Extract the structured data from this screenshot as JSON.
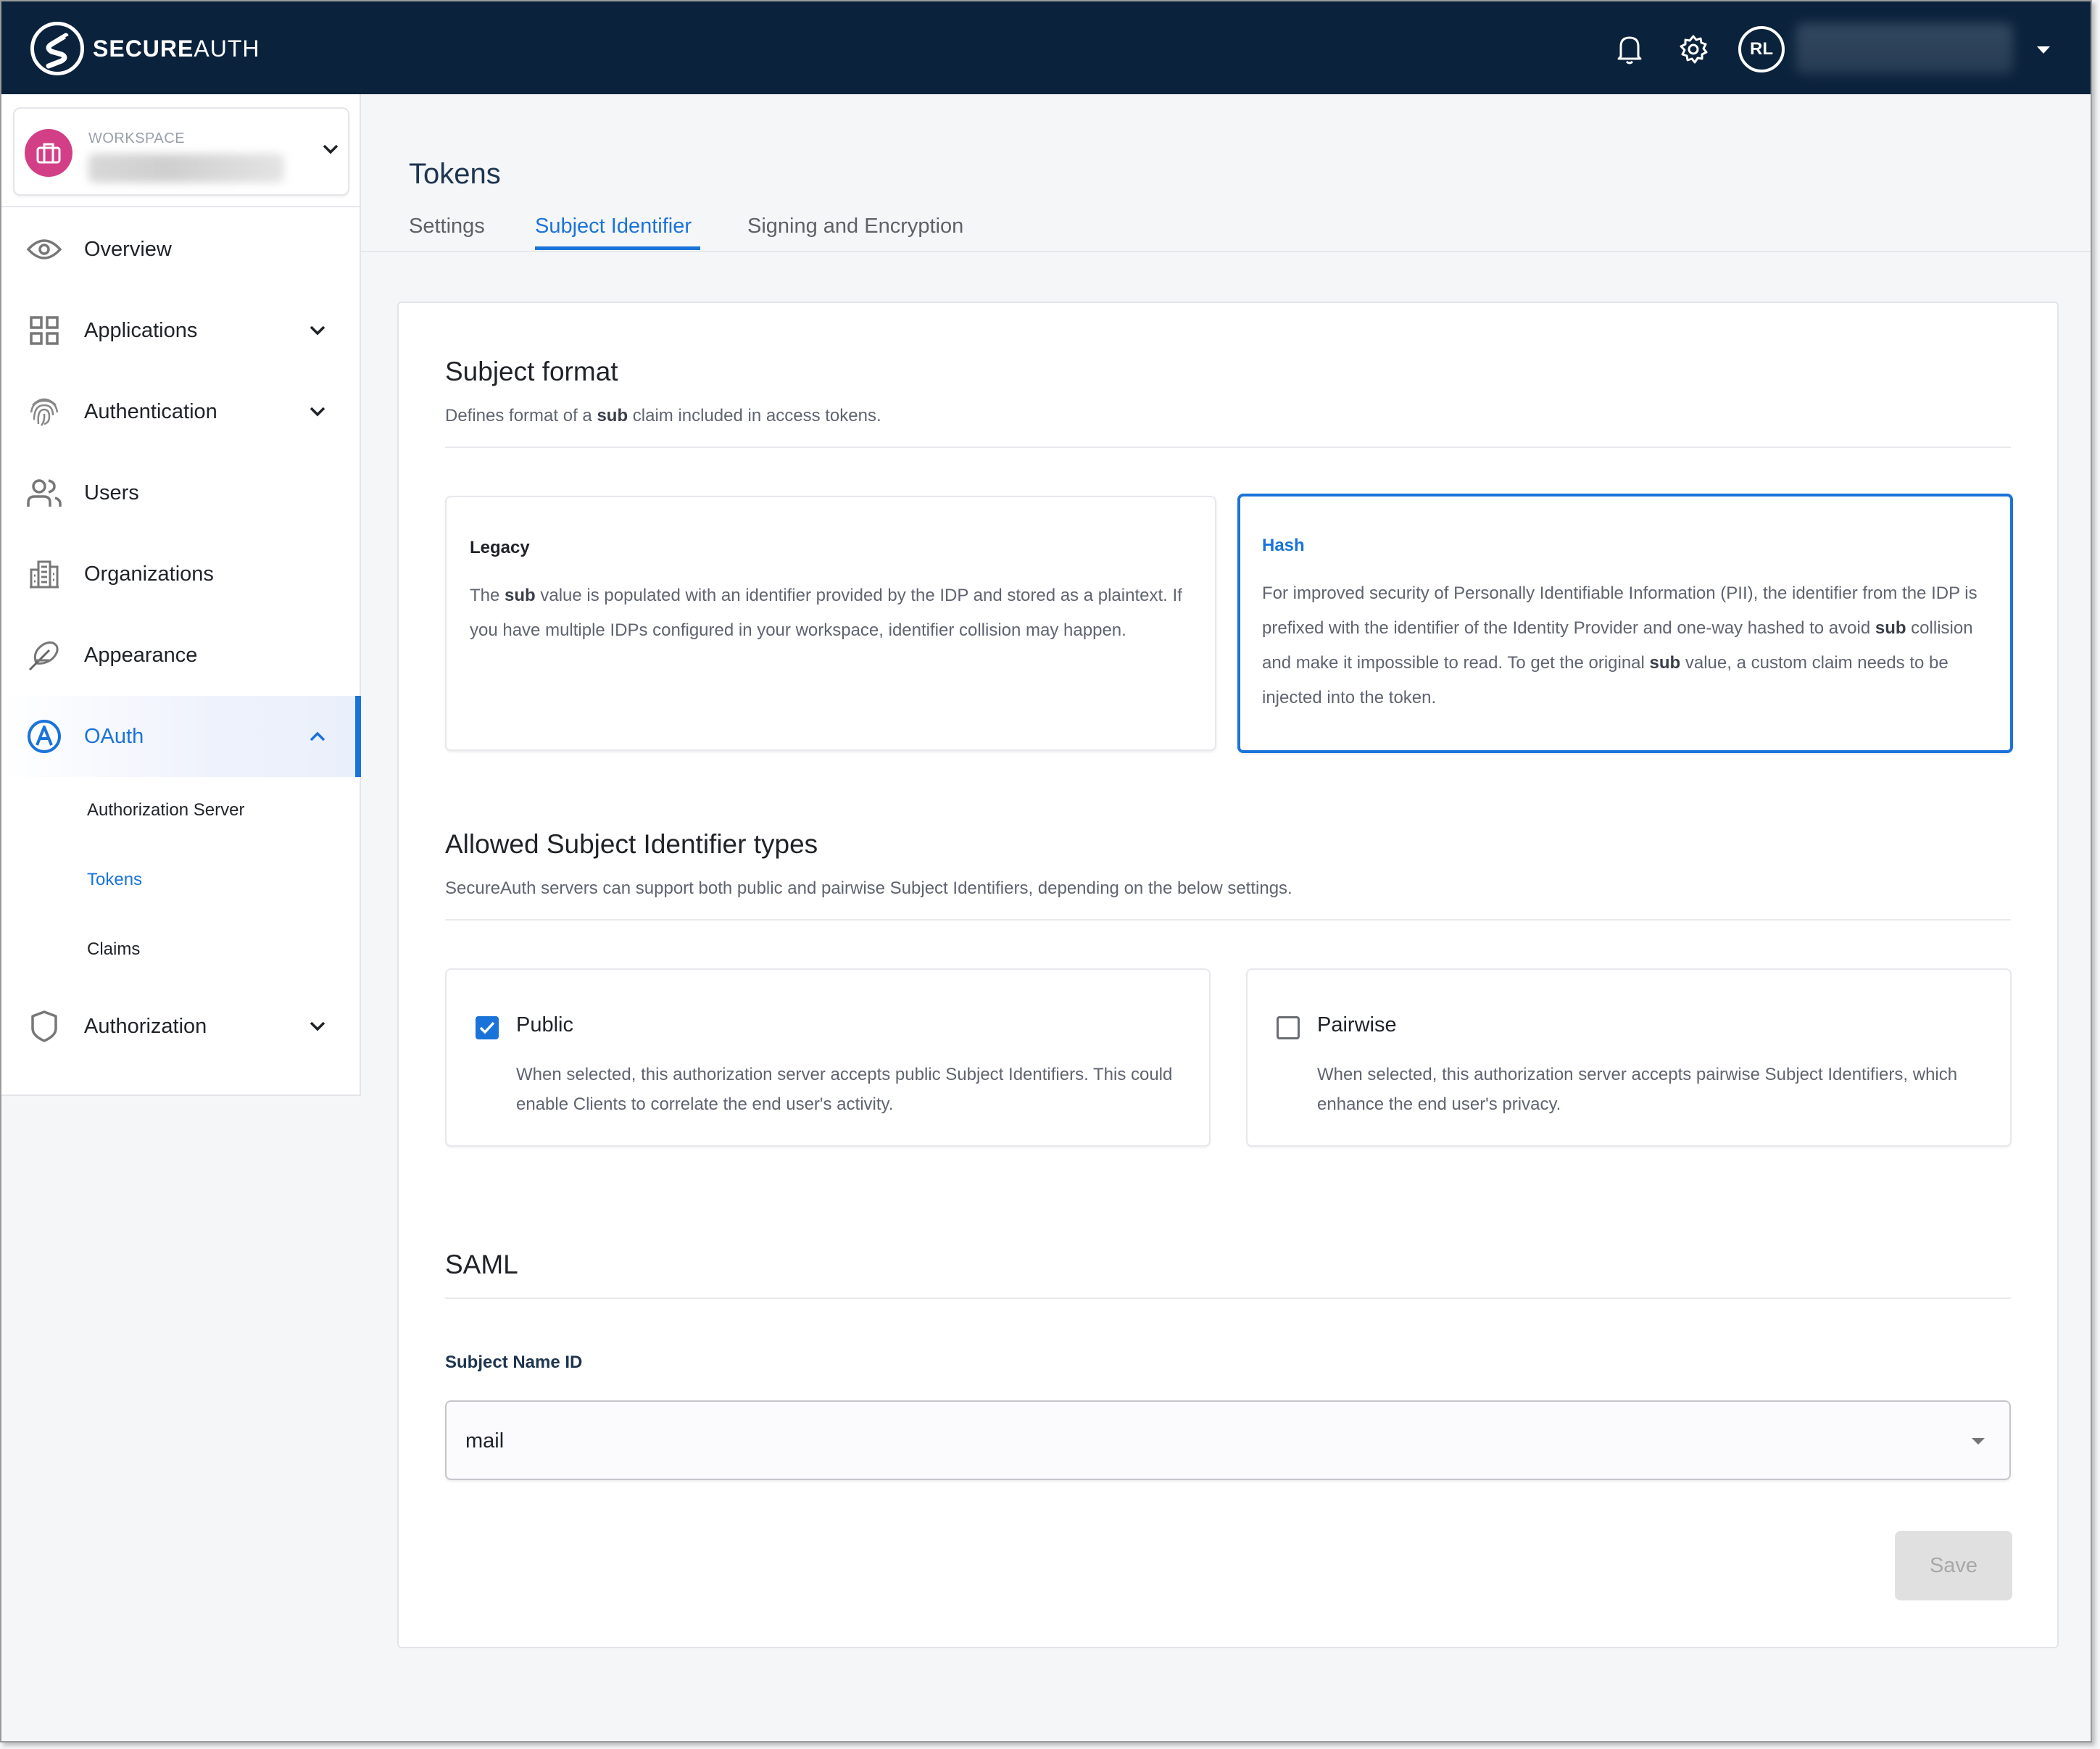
{
  "app": {
    "brand_bold": "SECURE",
    "brand_light": "AUTH"
  },
  "header": {
    "notifications_icon": "bell-icon",
    "settings_icon": "gear-icon",
    "avatar_initials": "RL",
    "user_menu_icon": "caret-down-icon"
  },
  "workspace": {
    "label": "WORKSPACE",
    "icon": "briefcase-icon"
  },
  "sidebar": {
    "items": [
      {
        "label": "Overview",
        "icon": "eye-icon",
        "expandable": false
      },
      {
        "label": "Applications",
        "icon": "grid-icon",
        "expandable": true
      },
      {
        "label": "Authentication",
        "icon": "fingerprint-icon",
        "expandable": true
      },
      {
        "label": "Users",
        "icon": "users-icon",
        "expandable": false
      },
      {
        "label": "Organizations",
        "icon": "buildings-icon",
        "expandable": false
      },
      {
        "label": "Appearance",
        "icon": "feather-icon",
        "expandable": false
      },
      {
        "label": "OAuth",
        "icon": "oauth-icon",
        "expandable": true,
        "expanded": true,
        "active": true
      },
      {
        "label": "Authorization",
        "icon": "shield-icon",
        "expandable": true
      }
    ],
    "oauth_sub_items": [
      {
        "label": "Authorization Server"
      },
      {
        "label": "Tokens",
        "active": true
      },
      {
        "label": "Claims"
      }
    ]
  },
  "page": {
    "title": "Tokens",
    "tabs": [
      {
        "label": "Settings"
      },
      {
        "label": "Subject Identifier",
        "active": true
      },
      {
        "label": "Signing and Encryption"
      }
    ]
  },
  "subject_format": {
    "title": "Subject format",
    "desc_pre": "Defines format of a ",
    "desc_bold": "sub",
    "desc_post": " claim included in access tokens.",
    "options": [
      {
        "title": "Legacy",
        "selected": false,
        "text_1": "The ",
        "bold_1": "sub",
        "text_2": " value is populated with an identifier provided by the IDP and stored as a plaintext. If you have multiple IDPs configured in your workspace, identifier collision may happen."
      },
      {
        "title": "Hash",
        "selected": true,
        "text_1": "For improved security of Personally Identifiable Information (PII), the identifier from the IDP is prefixed with the identifier of the Identity Provider and one-way hashed to avoid ",
        "bold_1": "sub",
        "text_2": " collision and make it impossible to read. To get the original ",
        "bold_2": "sub",
        "text_3": " value, a custom claim needs to be injected into the token."
      }
    ]
  },
  "allowed_types": {
    "title": "Allowed Subject Identifier types",
    "desc": "SecureAuth servers can support both public and pairwise Subject Identifiers, depending on the below settings.",
    "options": [
      {
        "label": "Public",
        "checked": true,
        "desc": "When selected, this authorization server accepts public Subject Identifiers. This could enable Clients to correlate the end user's activity."
      },
      {
        "label": "Pairwise",
        "checked": false,
        "desc": "When selected, this authorization server accepts pairwise Subject Identifiers, which enhance the end user's privacy."
      }
    ]
  },
  "saml": {
    "title": "SAML",
    "field_label": "Subject Name ID",
    "selected_value": "mail"
  },
  "actions": {
    "save_label": "Save",
    "save_disabled": true
  },
  "colors": {
    "header_bg": "#0b223c",
    "accent": "#1a73d9",
    "workspace_badge": "#d23f87",
    "disabled_button_bg": "#e0e0e0"
  }
}
